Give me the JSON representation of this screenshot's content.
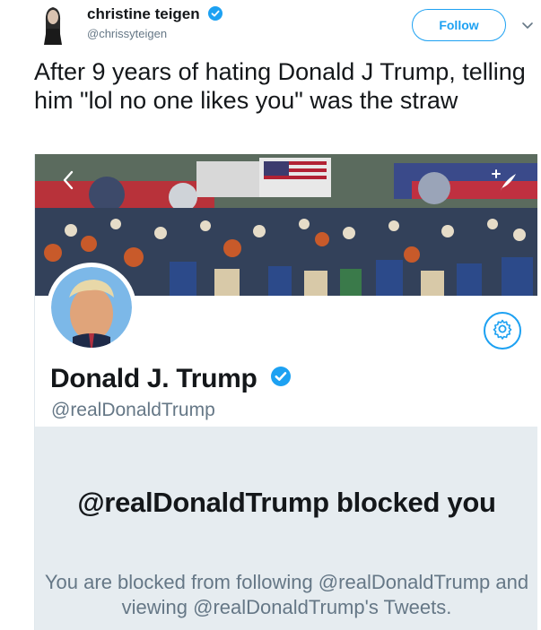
{
  "tweet": {
    "author_name": "christine teigen",
    "author_handle": "@chrissyteigen",
    "follow_label": "Follow",
    "text": "After 9 years of hating Donald J Trump, telling him \"lol no one likes you\" was the straw"
  },
  "embedded_profile": {
    "name": "Donald J. Trump",
    "handle": "@realDonaldTrump",
    "blocked_title": "@realDonaldTrump blocked you",
    "blocked_message": "You are blocked from following @realDonaldTrump and viewing @realDonaldTrump's Tweets."
  },
  "icons": {
    "verified": "verified-badge-icon",
    "caret": "chevron-down-icon",
    "back": "chevron-left-icon",
    "compose": "compose-feather-icon",
    "settings": "gear-icon"
  },
  "colors": {
    "accent": "#1da1f2",
    "text_primary": "#14171a",
    "text_secondary": "#657786",
    "panel_background": "#e6ecf0"
  }
}
